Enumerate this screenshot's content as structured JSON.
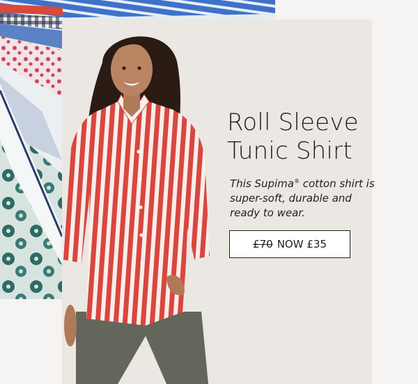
{
  "product": {
    "title_line1": "Roll Sleeve",
    "title_line2": "Tunic Shirt",
    "desc_before": "This Supima",
    "desc_mark": "®",
    "desc_after": " cotton shirt is super-soft, durable and ready to wear."
  },
  "price": {
    "old": "£70",
    "now": "NOW £35"
  },
  "colors": {
    "card_bg": "#ebe7e3",
    "page_bg": "#f5f4f3",
    "shirt_red": "#d8473f"
  }
}
